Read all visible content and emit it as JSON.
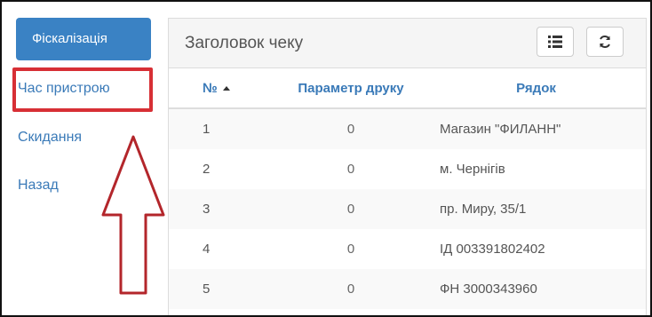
{
  "sidebar": {
    "items": [
      {
        "label": "Фіскалізація"
      },
      {
        "label": "Час пристрою"
      },
      {
        "label": "Скидання"
      },
      {
        "label": "Назад"
      }
    ]
  },
  "panel": {
    "title": "Заголовок чеку",
    "toolbar": [
      {
        "icon": "list-icon"
      },
      {
        "icon": "refresh-icon"
      }
    ]
  },
  "table": {
    "headers": [
      "№",
      "Параметр друку",
      "Рядок"
    ],
    "rows": [
      [
        "1",
        "0",
        "Магазин \"ФИЛАНН\""
      ],
      [
        "2",
        "0",
        "м. Чернігів"
      ],
      [
        "3",
        "0",
        "пр. Миру, 35/1"
      ],
      [
        "4",
        "0",
        "ІД 003391802402"
      ],
      [
        "5",
        "0",
        "ФН 3000343960"
      ]
    ]
  },
  "colors": {
    "active_bg": "#3a82c4",
    "link": "#3a7ab8",
    "highlight": "#d72f35"
  }
}
